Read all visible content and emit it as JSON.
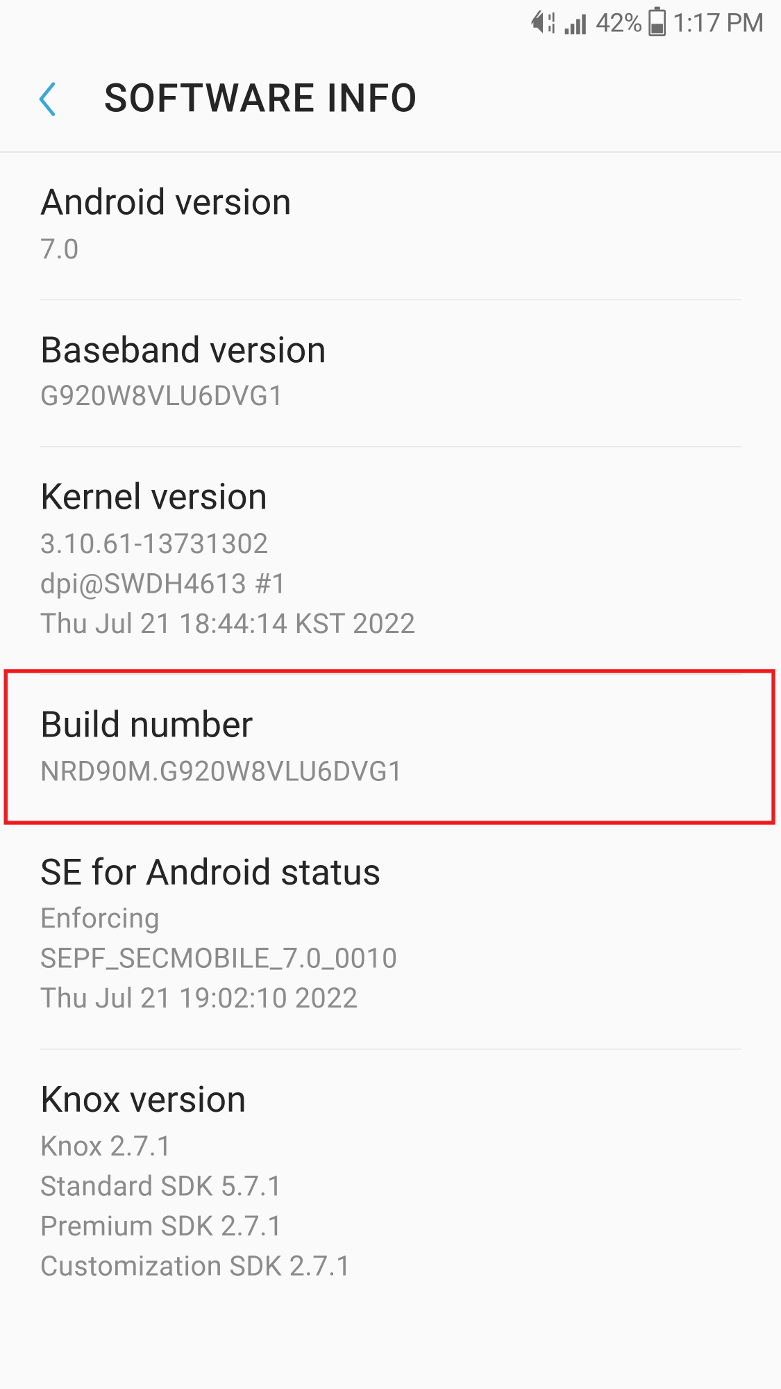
{
  "statusbar": {
    "battery_pct": "42%",
    "time": "1:17 PM"
  },
  "header": {
    "title": "SOFTWARE INFO"
  },
  "list": {
    "items": [
      {
        "label": "Android version",
        "value": "7.0"
      },
      {
        "label": "Baseband version",
        "value": "G920W8VLU6DVG1"
      },
      {
        "label": "Kernel version",
        "value": "3.10.61-13731302\ndpi@SWDH4613 #1\nThu Jul 21 18:44:14 KST 2022"
      },
      {
        "label": "Build number",
        "value": "NRD90M.G920W8VLU6DVG1"
      },
      {
        "label": "SE for Android status",
        "value": "Enforcing\nSEPF_SECMOBILE_7.0_0010\nThu Jul 21 19:02:10 2022"
      },
      {
        "label": "Knox version",
        "value": "Knox 2.7.1\nStandard SDK 5.7.1\nPremium SDK 2.7.1\nCustomization SDK 2.7.1"
      }
    ]
  },
  "highlight": {
    "target_label": "Build number"
  }
}
